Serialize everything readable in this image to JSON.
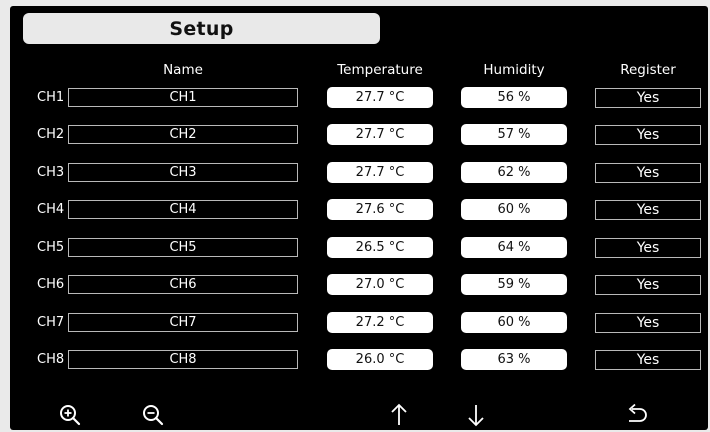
{
  "header": {
    "title": "Setup"
  },
  "columns": {
    "name": "Name",
    "temperature": "Temperature",
    "humidity": "Humidity",
    "register": "Register"
  },
  "channels": [
    {
      "label": "CH1",
      "name": "CH1",
      "temperature": "27.7 °C",
      "humidity": "56 %",
      "register": "Yes"
    },
    {
      "label": "CH2",
      "name": "CH2",
      "temperature": "27.7 °C",
      "humidity": "57 %",
      "register": "Yes"
    },
    {
      "label": "CH3",
      "name": "CH3",
      "temperature": "27.7 °C",
      "humidity": "62 %",
      "register": "Yes"
    },
    {
      "label": "CH4",
      "name": "CH4",
      "temperature": "27.6 °C",
      "humidity": "60 %",
      "register": "Yes"
    },
    {
      "label": "CH5",
      "name": "CH5",
      "temperature": "26.5 °C",
      "humidity": "64 %",
      "register": "Yes"
    },
    {
      "label": "CH6",
      "name": "CH6",
      "temperature": "27.0 °C",
      "humidity": "59 %",
      "register": "Yes"
    },
    {
      "label": "CH7",
      "name": "CH7",
      "temperature": "27.2 °C",
      "humidity": "60 %",
      "register": "Yes"
    },
    {
      "label": "CH8",
      "name": "CH8",
      "temperature": "26.0 °C",
      "humidity": "63 %",
      "register": "Yes"
    }
  ],
  "toolbar": {
    "icons": [
      "zoom-in-icon",
      "zoom-out-icon",
      "arrow-up-icon",
      "arrow-down-icon",
      "back-icon"
    ]
  },
  "colors": {
    "background": "#000000",
    "title_bar": "#e9e9e9",
    "pill": "#ffffff",
    "field_border": "#b9b9b9",
    "text": "#ffffff"
  }
}
